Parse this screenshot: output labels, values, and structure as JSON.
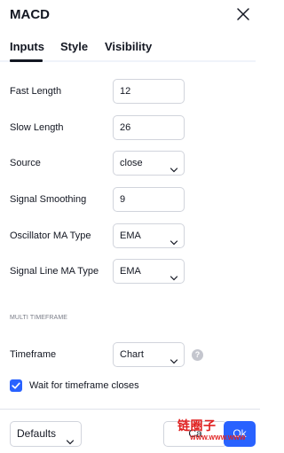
{
  "dialog": {
    "title": "MACD"
  },
  "tabs": [
    {
      "label": "Inputs",
      "active": true
    },
    {
      "label": "Style",
      "active": false
    },
    {
      "label": "Visibility",
      "active": false
    }
  ],
  "inputs": {
    "fast_length": {
      "label": "Fast Length",
      "value": "12"
    },
    "slow_length": {
      "label": "Slow Length",
      "value": "26"
    },
    "source": {
      "label": "Source",
      "value": "close"
    },
    "signal_smoothing": {
      "label": "Signal Smoothing",
      "value": "9"
    },
    "oscillator_ma_type": {
      "label": "Oscillator MA Type",
      "value": "EMA"
    },
    "signal_line_ma_type": {
      "label": "Signal Line MA Type",
      "value": "EMA"
    }
  },
  "multi_timeframe": {
    "section_label": "MULTI TIMEFRAME",
    "timeframe": {
      "label": "Timeframe",
      "value": "Chart"
    },
    "help_glyph": "?",
    "wait_for_close": {
      "label": "Wait for timeframe closes",
      "checked": true
    }
  },
  "footer": {
    "defaults_label": "Defaults",
    "cancel_label": "Ca",
    "ok_label": "Ok"
  },
  "watermark": {
    "text": "链圈子",
    "sub": "WWW.WWW.WWW"
  },
  "colors": {
    "accent": "#2962ff",
    "text": "#131722",
    "muted": "#787b86",
    "border": "#d1d4dc",
    "watermark": "#e02020"
  },
  "icons": {
    "close": "close-icon",
    "chevron": "chevron-down-icon",
    "help": "question-circle-icon",
    "check": "checkmark-icon"
  }
}
